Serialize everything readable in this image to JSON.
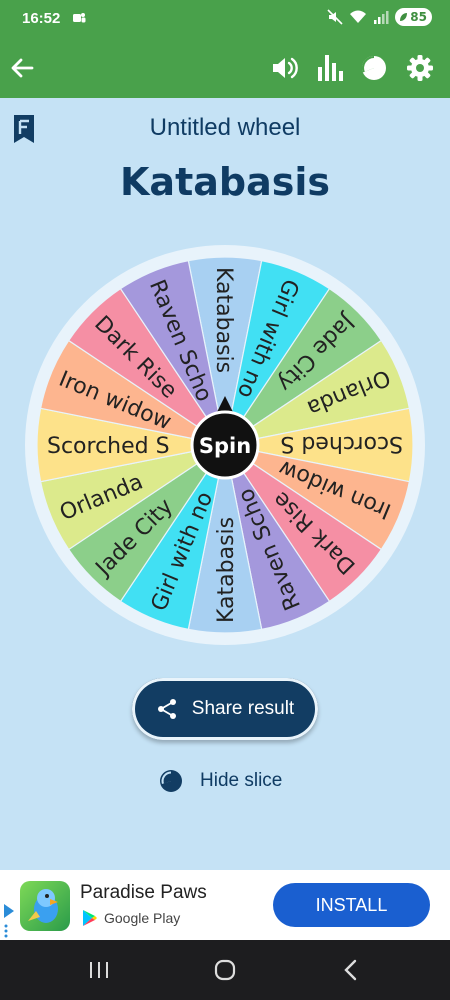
{
  "status": {
    "time": "16:52",
    "battery": "85"
  },
  "app_bar": {
    "icons": [
      "back-arrow-icon",
      "volume-icon",
      "bar-chart-icon",
      "pie-chart-icon",
      "gear-icon"
    ],
    "accent_color": "#49a14b"
  },
  "wheel": {
    "subtitle": "Untitled wheel",
    "title": "Katabasis",
    "spin_label": "Spin",
    "slices": [
      {
        "label": "Katabasis",
        "color": "#a8d0f2"
      },
      {
        "label": "Girl with no",
        "color": "#41e0f3"
      },
      {
        "label": "Jade City",
        "color": "#8ccf8a"
      },
      {
        "label": "Orlanda",
        "color": "#dcea8c"
      },
      {
        "label": "Scorched S",
        "color": "#fde28a"
      },
      {
        "label": "Iron widow",
        "color": "#fdb58f"
      },
      {
        "label": "Dark Rise",
        "color": "#f58fa4"
      },
      {
        "label": "Raven Scho",
        "color": "#a498dc"
      },
      {
        "label": "Katabasis",
        "color": "#a8d0f2"
      },
      {
        "label": "Girl with no",
        "color": "#41e0f3"
      },
      {
        "label": "Jade City",
        "color": "#8ccf8a"
      },
      {
        "label": "Orlanda",
        "color": "#dcea8c"
      },
      {
        "label": "Scorched S",
        "color": "#fde28a"
      },
      {
        "label": "Iron widow",
        "color": "#fdb58f"
      },
      {
        "label": "Dark Rise",
        "color": "#f58fa4"
      },
      {
        "label": "Raven Scho",
        "color": "#a498dc"
      }
    ]
  },
  "actions": {
    "share_label": "Share result",
    "hide_label": "Hide slice"
  },
  "ad": {
    "title": "Paradise Paws",
    "store": "Google Play",
    "install_label": "INSTALL"
  },
  "nav": {
    "icons": [
      "recent-apps-icon",
      "home-icon",
      "back-icon"
    ]
  }
}
